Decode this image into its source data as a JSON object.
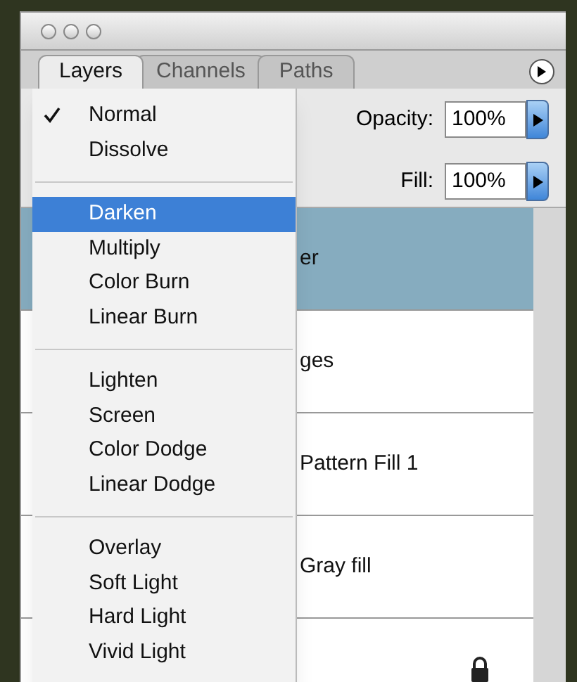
{
  "tabs": [
    {
      "label": "Layers",
      "selected": true
    },
    {
      "label": "Channels",
      "selected": false
    },
    {
      "label": "Paths",
      "selected": false
    }
  ],
  "opacity": {
    "label": "Opacity:",
    "value": "100%"
  },
  "fill": {
    "label": "Fill:",
    "value": "100%"
  },
  "layers": [
    {
      "name": "er",
      "selected": true,
      "locked": false
    },
    {
      "name": "ges",
      "selected": false,
      "locked": false
    },
    {
      "name": "Pattern Fill 1",
      "selected": false,
      "locked": false
    },
    {
      "name": "Gray fill",
      "selected": false,
      "locked": false
    },
    {
      "selected": false,
      "locked": true
    }
  ],
  "blend_menu": [
    [
      {
        "label": "Normal",
        "checked": true,
        "selected": false
      },
      {
        "label": "Dissolve",
        "checked": false,
        "selected": false
      }
    ],
    [
      {
        "label": "Darken",
        "checked": false,
        "selected": true
      },
      {
        "label": "Multiply",
        "checked": false,
        "selected": false
      },
      {
        "label": "Color Burn",
        "checked": false,
        "selected": false
      },
      {
        "label": "Linear Burn",
        "checked": false,
        "selected": false
      }
    ],
    [
      {
        "label": "Lighten",
        "checked": false,
        "selected": false
      },
      {
        "label": "Screen",
        "checked": false,
        "selected": false
      },
      {
        "label": "Color Dodge",
        "checked": false,
        "selected": false
      },
      {
        "label": "Linear Dodge",
        "checked": false,
        "selected": false
      }
    ],
    [
      {
        "label": "Overlay",
        "checked": false,
        "selected": false
      },
      {
        "label": "Soft Light",
        "checked": false,
        "selected": false
      },
      {
        "label": "Hard Light",
        "checked": false,
        "selected": false
      },
      {
        "label": "Vivid Light",
        "checked": false,
        "selected": false
      }
    ]
  ]
}
